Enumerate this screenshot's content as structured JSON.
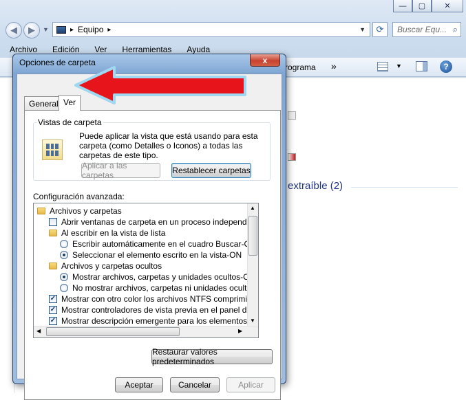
{
  "explorer": {
    "address_separator": "▸",
    "address_text": "Equipo",
    "search_placeholder": "Buscar Equ...",
    "menu": [
      "Archivo",
      "Edición",
      "Ver",
      "Herramientas",
      "Ayuda"
    ],
    "cmd_partial": "rograma",
    "cmd_more": "»",
    "content_text": "extraíble (2)"
  },
  "dialog": {
    "title": "Opciones de carpeta",
    "close_label": "x",
    "tabs": [
      "General",
      "Ver"
    ],
    "views_group": {
      "legend": "Vistas de carpeta",
      "description": "Puede aplicar la vista que está usando para esta carpeta (como Detalles o Iconos) a todas las carpetas de este tipo.",
      "apply_button": "Aplicar a las carpetas",
      "reset_button": "Restablecer carpetas"
    },
    "advanced_label": "Configuración avanzada:",
    "tree_items": [
      {
        "kind": "folder",
        "indent": 0,
        "label": "Archivos y carpetas"
      },
      {
        "kind": "checkbox",
        "checked": false,
        "indent": 1,
        "label": "Abrir ventanas de carpeta  en un proceso independiente-"
      },
      {
        "kind": "folder",
        "indent": 1,
        "label": "Al escribir en la vista de lista"
      },
      {
        "kind": "radio",
        "checked": false,
        "indent": 2,
        "label": "Escribir automáticamente en el cuadro Buscar-OFF"
      },
      {
        "kind": "radio",
        "checked": true,
        "indent": 2,
        "label": "Seleccionar el elemento escrito en la vista-ON"
      },
      {
        "kind": "folder",
        "indent": 1,
        "label": "Archivos y carpetas ocultos"
      },
      {
        "kind": "radio",
        "checked": true,
        "indent": 2,
        "label": "Mostrar archivos, carpetas y unidades ocultos-ON"
      },
      {
        "kind": "radio",
        "checked": false,
        "indent": 2,
        "label": "No mostrar archivos, carpetas ni unidades ocultos-OF"
      },
      {
        "kind": "checkbox",
        "checked": true,
        "indent": 1,
        "label": "Mostrar con otro color los archivos NTFS comprimidos o c"
      },
      {
        "kind": "checkbox",
        "checked": true,
        "indent": 1,
        "label": "Mostrar controladores de vista previa en el panel de vista"
      },
      {
        "kind": "checkbox",
        "checked": true,
        "indent": 1,
        "label": "Mostrar descripción emergente para los elementos de car"
      }
    ],
    "restore_button": "Restaurar valores predeterminados",
    "ok_button": "Aceptar",
    "cancel_button": "Cancelar",
    "apply_button": "Aplicar"
  },
  "colors": {
    "arrow_fill": "#e8141b",
    "arrow_stroke": "#9fd8f0"
  }
}
